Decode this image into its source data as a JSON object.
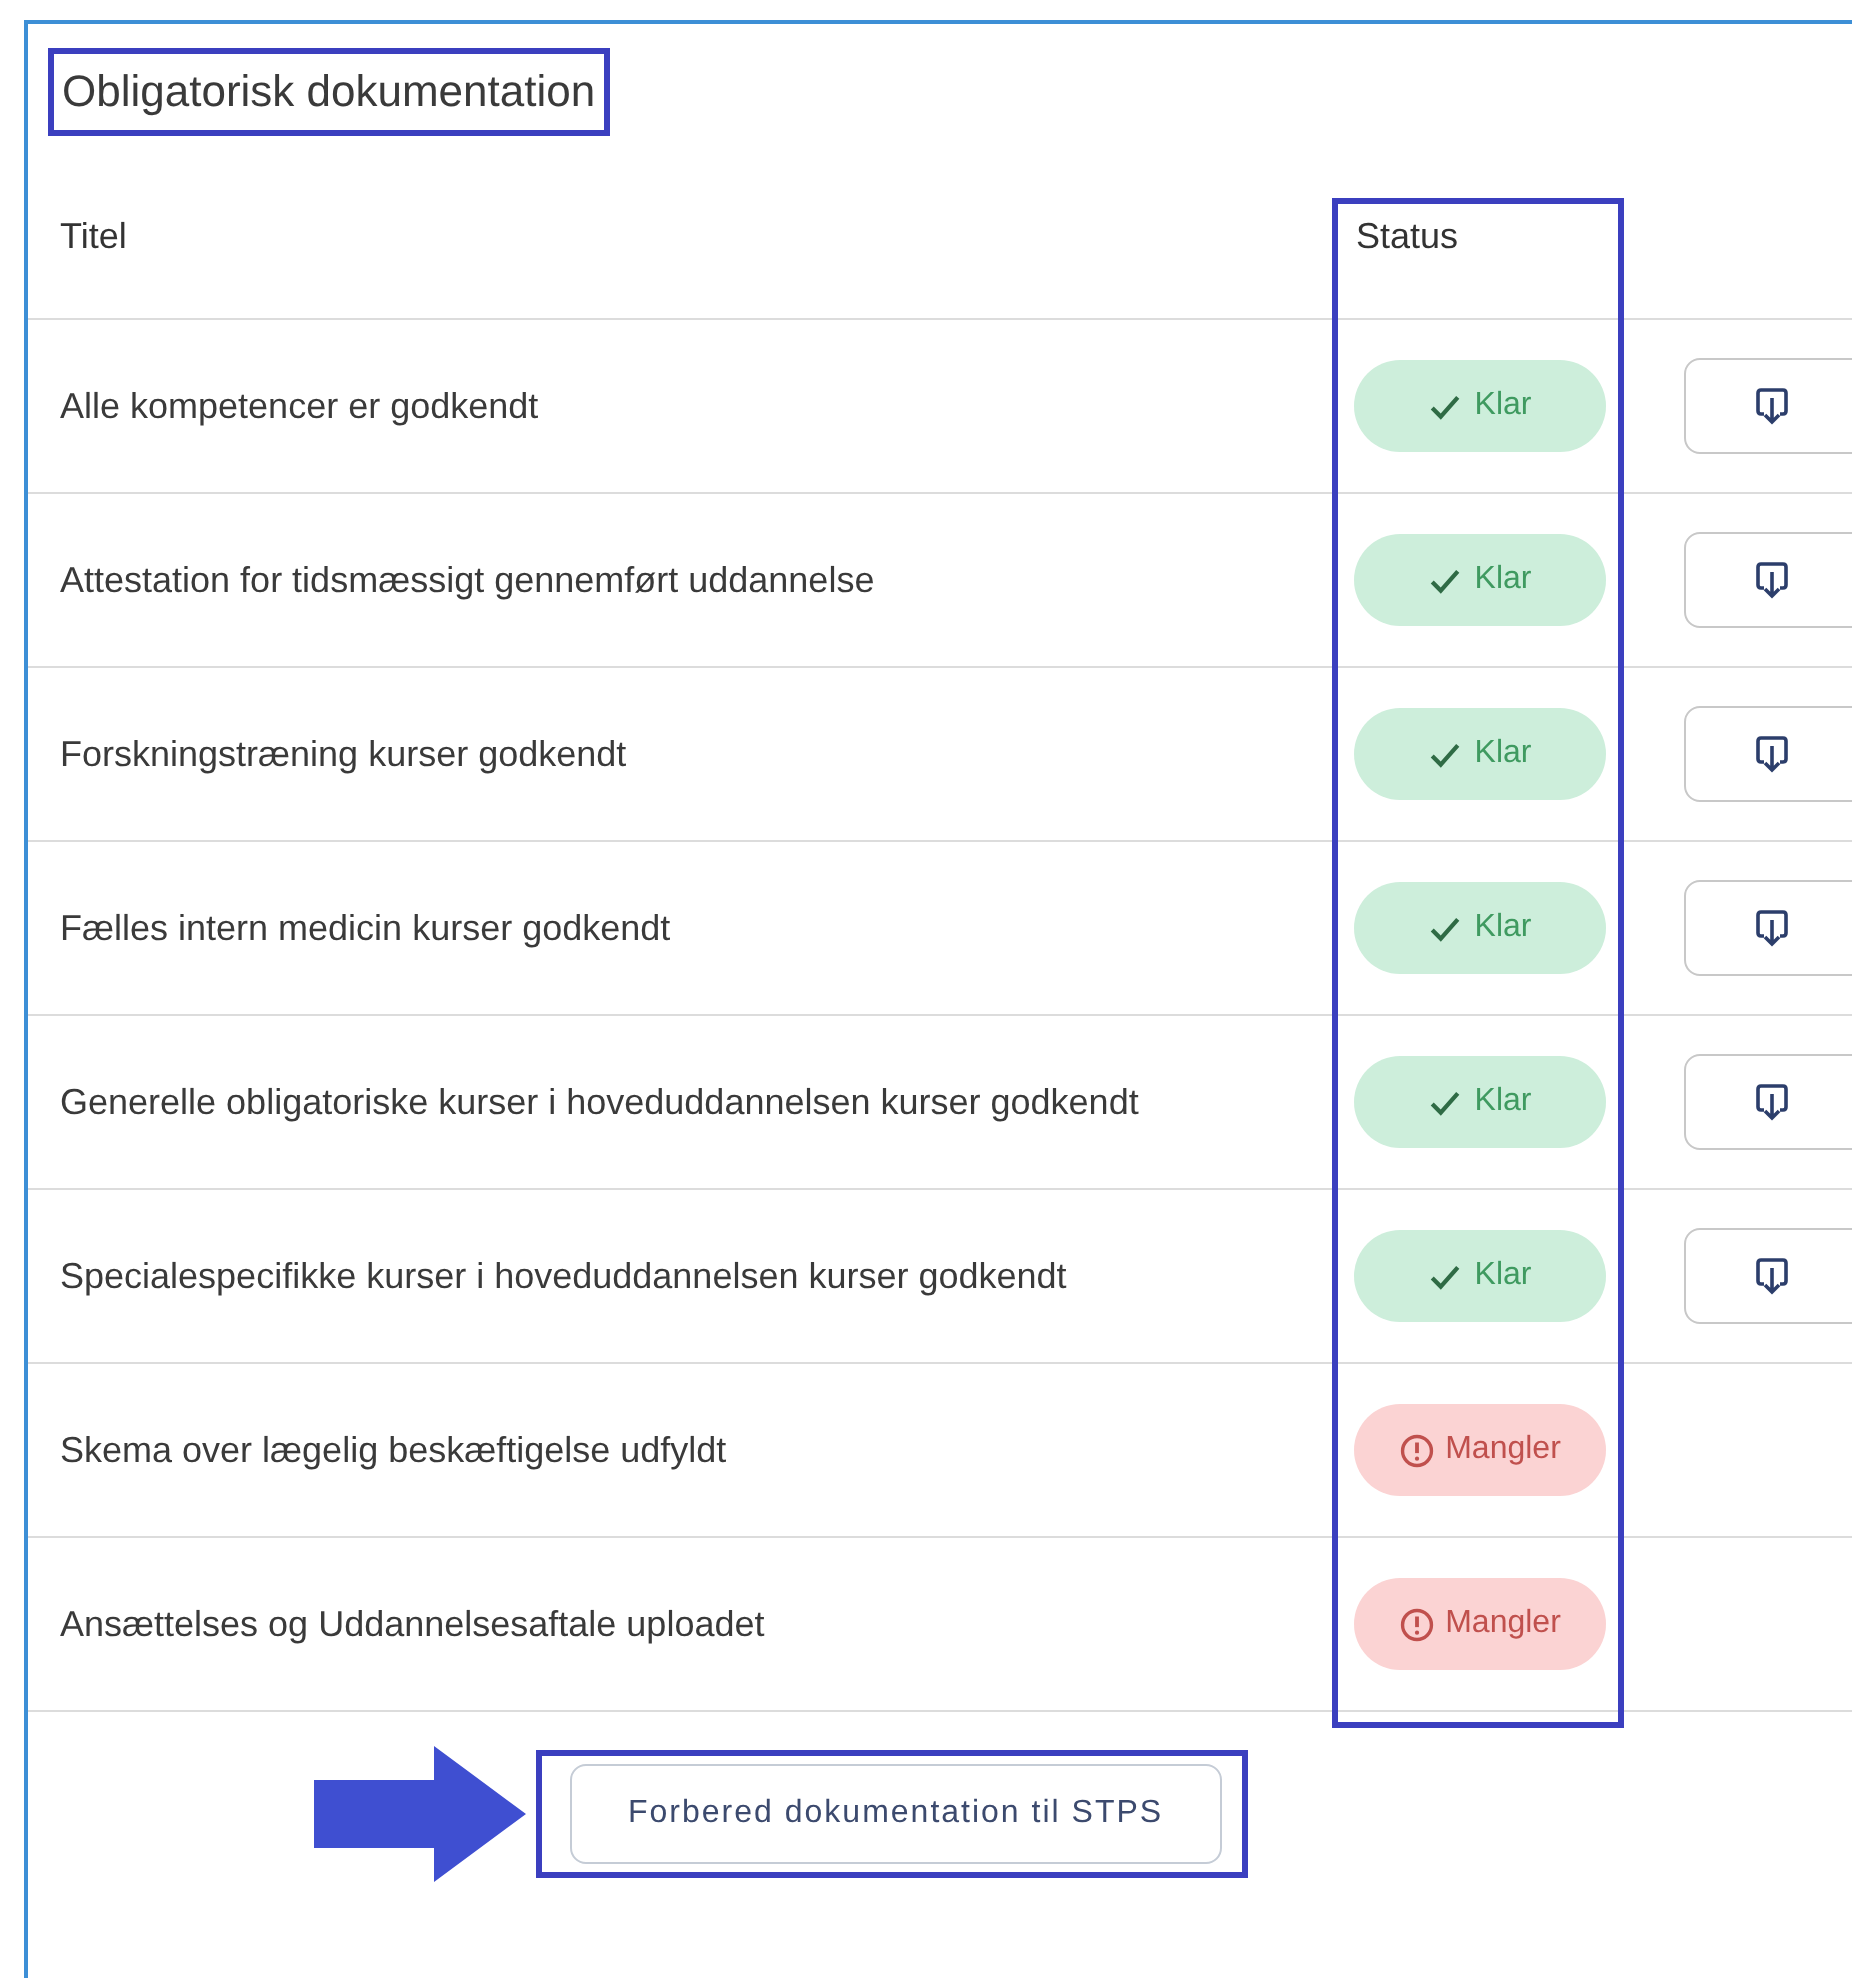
{
  "section": {
    "title": "Obligatorisk dokumentation",
    "title_highlighted": true
  },
  "table": {
    "columns": [
      {
        "label": "Titel"
      },
      {
        "label": "Status",
        "highlighted": true
      }
    ],
    "rows": [
      {
        "title": "Alle kompetencer er godkendt",
        "status": {
          "kind": "ready",
          "label": "Klar"
        },
        "has_download": true
      },
      {
        "title": "Attestation for tidsmæssigt gennemført uddannelse",
        "status": {
          "kind": "ready",
          "label": "Klar"
        },
        "has_download": true
      },
      {
        "title": "Forskningstræning kurser godkendt",
        "status": {
          "kind": "ready",
          "label": "Klar"
        },
        "has_download": true
      },
      {
        "title": "Fælles intern medicin kurser godkendt",
        "status": {
          "kind": "ready",
          "label": "Klar"
        },
        "has_download": true
      },
      {
        "title": "Generelle obligatoriske kurser i hoveduddannelsen kurser godkendt",
        "status": {
          "kind": "ready",
          "label": "Klar"
        },
        "has_download": true
      },
      {
        "title": "Specialespecifikke kurser i hoveduddannelsen kurser godkendt",
        "status": {
          "kind": "ready",
          "label": "Klar"
        },
        "has_download": true
      },
      {
        "title": "Skema over lægelig beskæftigelse udfyldt",
        "status": {
          "kind": "missing",
          "label": "Mangler"
        },
        "has_download": false
      },
      {
        "title": "Ansættelses og Uddannelsesaftale uploadet",
        "status": {
          "kind": "missing",
          "label": "Mangler"
        },
        "has_download": false
      }
    ]
  },
  "action_button": {
    "label": "Forbered dokumentation til STPS",
    "highlighted": true,
    "arrow": true
  }
}
